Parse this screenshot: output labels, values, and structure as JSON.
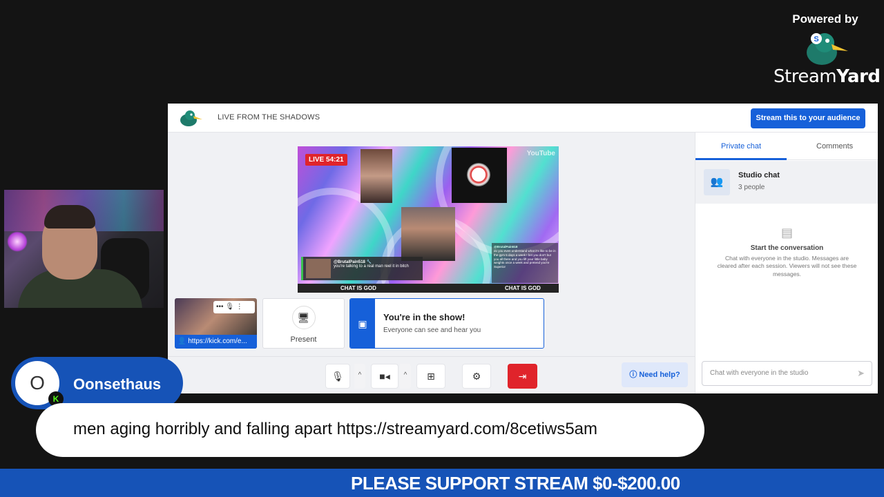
{
  "brand": {
    "powered_by": "Powered by",
    "name_light": "Stream",
    "name_bold": "Yard",
    "logo_letter": "S"
  },
  "studio": {
    "title": "LIVE FROM THE SHADOWS",
    "stream_button": "Stream this to your audience",
    "stage": {
      "live_badge": "LIVE 54:21",
      "platform": "YouTube",
      "comment_user": "@BrutalPain518 🔧",
      "comment_text": "you're talking to a real man reel it in bitch",
      "side_user": "@BrutalPain518",
      "side_text": "do you even understand what it's like to be in the gym 5 days a week I bet you don't but you all there and you lift your little baby weights once a week and pretend you're Superior",
      "ticker_left": "CHAT IS GOD",
      "ticker_right": "CHAT IS GOD"
    },
    "self_tile_url": "https://kick.com/e...",
    "present_label": "Present",
    "show_title": "You're in the show!",
    "show_subtitle": "Everyone can see and hear you",
    "help_button": "Need help?",
    "sidebar": {
      "tabs": [
        "Private chat",
        "Comments"
      ],
      "studio_chat_name": "Studio chat",
      "studio_chat_count": "3 people",
      "empty_title": "Start the conversation",
      "empty_text": "Chat with everyone in the studio. Messages are cleared after each session. Viewers will not see these messages.",
      "input_placeholder": "Chat with everyone in the studio"
    }
  },
  "overlay": {
    "avatar_letter": "O",
    "platform_badge": "K",
    "username": "Oonsethaus",
    "message": "men aging horribly and falling apart https://streamyard.com/8cetiws5am",
    "ticker": "PLEASE SUPPORT STREAM $0-$200.00"
  },
  "colors": {
    "accent": "#1660d9",
    "overlay_blue": "#1653b7",
    "live_red": "#e0242b",
    "kick_green": "#53fc18"
  }
}
